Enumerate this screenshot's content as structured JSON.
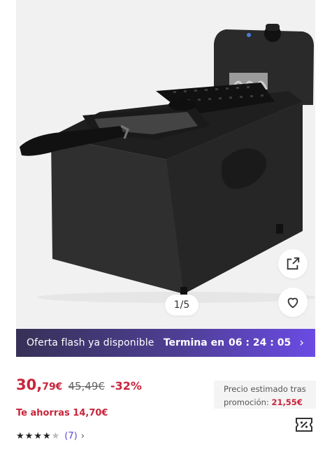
{
  "gallery": {
    "image_alt": "Freidora",
    "counter": "1/5",
    "share_icon": "external-link-icon",
    "favorite_icon": "heart-outline-icon"
  },
  "flash": {
    "left_text": "Oferta flash ya disponible",
    "timer_prefix": "Termina en",
    "timer": "06 : 24 : 05",
    "chevron": "›"
  },
  "price": {
    "int": "30,",
    "dec": "79€",
    "old": "45,49€",
    "discount": "-32%",
    "savings": "Te ahorras 14,70€"
  },
  "promo": {
    "line1": "Precio estimado tras",
    "line2": "promoción:",
    "value": "21,55€"
  },
  "rating": {
    "stars": 4.5,
    "count": "(7)",
    "chevron": "›"
  },
  "colors": {
    "accent": "#c9243b",
    "banner_start": "#363157",
    "banner_end": "#6a4be4",
    "link": "#5b47d6"
  }
}
